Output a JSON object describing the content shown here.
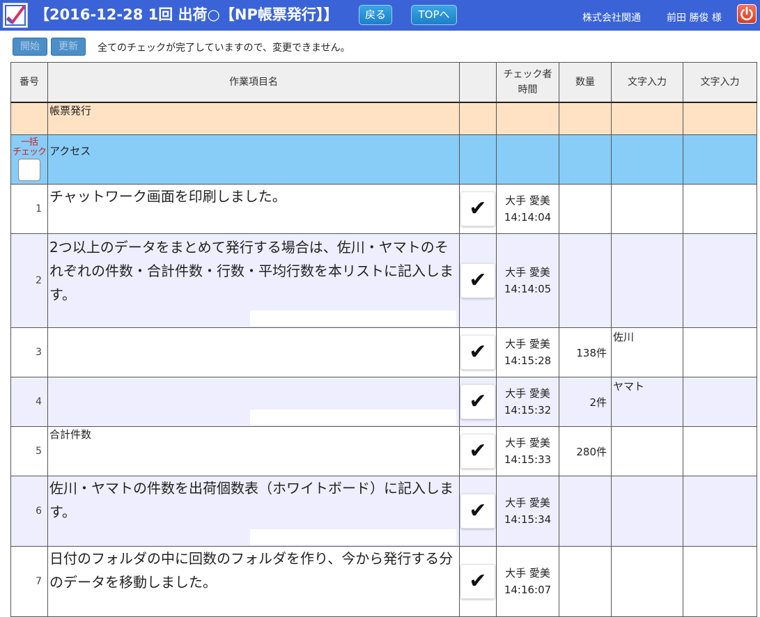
{
  "header": {
    "title": "【2016-12-28 1回 出荷○【NP帳票発行】】",
    "back_label": "戻る",
    "top_label": "TOPへ",
    "company": "株式会社関通",
    "user": "前田 勝俊 様"
  },
  "toolbar": {
    "start_label": "開始",
    "update_label": "更新",
    "notice": "全てのチェックが完了していますので、変更できません。"
  },
  "table": {
    "columns": {
      "no": "番号",
      "item": "作業項目名",
      "check": "",
      "checker_line1": "チェック者",
      "checker_line2": "時間",
      "qty": "数量",
      "text1": "文字入力",
      "text2": "文字入力"
    },
    "section1": {
      "label": "帳票発行"
    },
    "section2": {
      "bulk_line1": "一括",
      "bulk_line2": "チェック",
      "label": "アクセス"
    },
    "rows": [
      {
        "no": "1",
        "task": "チャットワーク画面を印刷しました。",
        "check": "✔",
        "checker": "大手 愛美",
        "time": "14:14:04",
        "qty": "",
        "text1": "",
        "text2": ""
      },
      {
        "no": "2",
        "task": "2つ以上のデータをまとめて発行する場合は、佐川・ヤマトのそれぞれの件数・合計件数・行数・平均行数を本リストに記入します。",
        "check": "✔",
        "checker": "大手 愛美",
        "time": "14:14:05",
        "qty": "",
        "text1": "",
        "text2": ""
      },
      {
        "no": "3",
        "task": "",
        "check": "✔",
        "checker": "大手 愛美",
        "time": "14:15:28",
        "qty": "138件",
        "text1": "佐川",
        "text2": ""
      },
      {
        "no": "4",
        "task": "",
        "check": "✔",
        "checker": "大手 愛美",
        "time": "14:15:32",
        "qty": "2件",
        "text1": "ヤマト",
        "text2": ""
      },
      {
        "no": "5",
        "task": "合計件数",
        "check": "✔",
        "checker": "大手 愛美",
        "time": "14:15:33",
        "qty": "280件",
        "text1": "",
        "text2": ""
      },
      {
        "no": "6",
        "task": "佐川・ヤマトの件数を出荷個数表（ホワイトボード）に記入します。",
        "check": "✔",
        "checker": "大手 愛美",
        "time": "14:15:34",
        "qty": "",
        "text1": "",
        "text2": ""
      },
      {
        "no": "7",
        "task": "日付のフォルダの中に回数のフォルダを作り、今から発行する分のデータを移動しました。",
        "check": "✔",
        "checker": "大手 愛美",
        "time": "14:16:07",
        "qty": "",
        "text1": "",
        "text2": ""
      }
    ]
  }
}
